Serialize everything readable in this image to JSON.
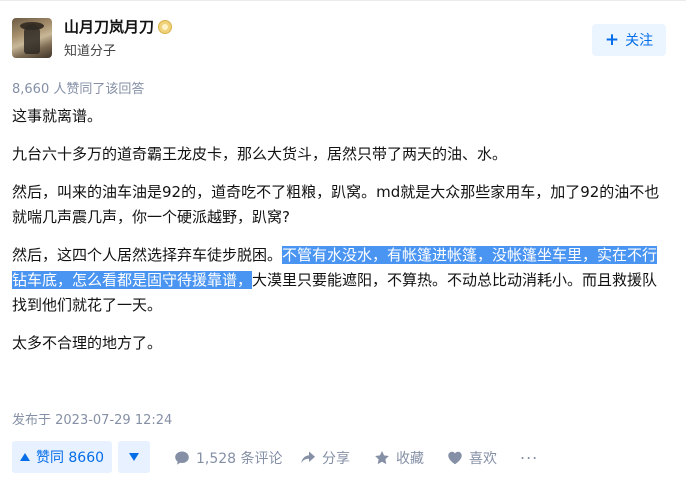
{
  "author": {
    "name": "山月刀岚月刀",
    "description": "知道分子",
    "follow_label": "关注",
    "follow_icon": "plus-icon"
  },
  "voters_text": "8,660 人赞同了该回答",
  "content": {
    "p1": "这事就离谱。",
    "p2": "九台六十多万的道奇霸王龙皮卡，那么大货斗，居然只带了两天的油、水。",
    "p3": "然后，叫来的油车油是92的，道奇吃不了粗粮，趴窝。md就是大众那些家用车，加了92的油不也就喘几声震几声，你一个硬派越野，趴窝?",
    "p4_before": "然后，这四个人居然选择弃车徒步脱困。",
    "p4_highlight": "不管有水没水，有帐篷进帐篷，没帐篷坐车里，实在不行钻车底，怎么看都是固守待援靠谱，",
    "p4_after": "大漠里只要能遮阳，不算热。不动总比动消耗小。而且救援队找到他们就花了一天。",
    "p5": "太多不合理的地方了。"
  },
  "published": "发布于 2023-07-29 12:24",
  "actions": {
    "vote_up_label": "赞同 8660",
    "comments_label": "1,528 条评论",
    "share_label": "分享",
    "favorite_label": "收藏",
    "like_label": "喜欢",
    "more_label": "..."
  },
  "colors": {
    "accent": "#056de8",
    "accent_bg": "#ebf5ff",
    "selection": "#4b95f2",
    "meta_gray": "#8590a6"
  }
}
